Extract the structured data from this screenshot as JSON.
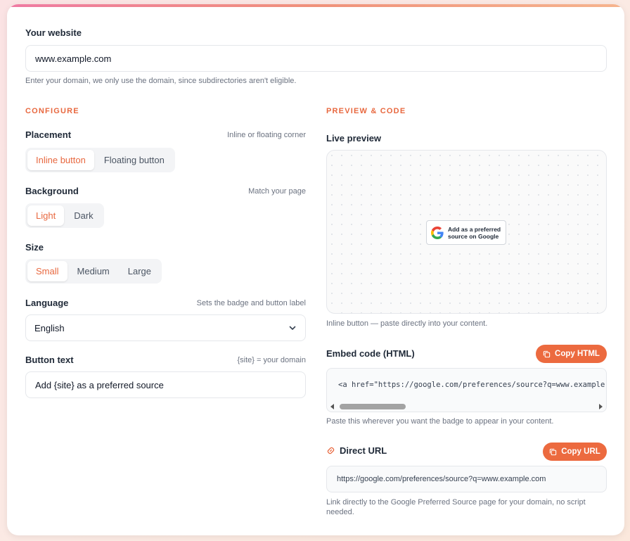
{
  "website": {
    "label": "Your website",
    "value": "www.example.com",
    "hint": "Enter your domain, we only use the domain, since subdirectories aren't eligible."
  },
  "configure": {
    "title": "CONFIGURE",
    "placement": {
      "label": "Placement",
      "hint": "Inline or floating corner",
      "options": [
        "Inline button",
        "Floating button"
      ],
      "selected": "Inline button"
    },
    "background": {
      "label": "Background",
      "hint": "Match your page",
      "options": [
        "Light",
        "Dark"
      ],
      "selected": "Light"
    },
    "size": {
      "label": "Size",
      "options": [
        "Small",
        "Medium",
        "Large"
      ],
      "selected": "Small"
    },
    "language": {
      "label": "Language",
      "hint": "Sets the badge and button label",
      "value": "English"
    },
    "button_text": {
      "label": "Button text",
      "hint": "{site} = your domain",
      "value": "Add {site} as a preferred source"
    }
  },
  "preview": {
    "title": "PREVIEW & CODE",
    "live_label": "Live preview",
    "badge_line1": "Add as a preferred",
    "badge_line2": "source on Google",
    "caption": "Inline button — paste directly into your content."
  },
  "embed": {
    "label": "Embed code (HTML)",
    "copy_label": "Copy HTML",
    "code": "<a href=\"https://google.com/preferences/source?q=www.example.com\" target=\"_blank\" rel=\"noopener\">",
    "hint": "Paste this wherever you want the badge to appear in your content."
  },
  "direct_url": {
    "label": "Direct URL",
    "copy_label": "Copy URL",
    "value": "https://google.com/preferences/source?q=www.example.com",
    "hint_line1": "Link directly to the Google Preferred Source page for your domain, no script",
    "hint_line2": "needed."
  },
  "colors": {
    "accent": "#e8683f",
    "button": "#ec6a3f"
  },
  "icons": {
    "dropdown": "chevron-down-icon",
    "copy": "copy-icon",
    "link": "link-icon",
    "google": "google-g-icon"
  }
}
